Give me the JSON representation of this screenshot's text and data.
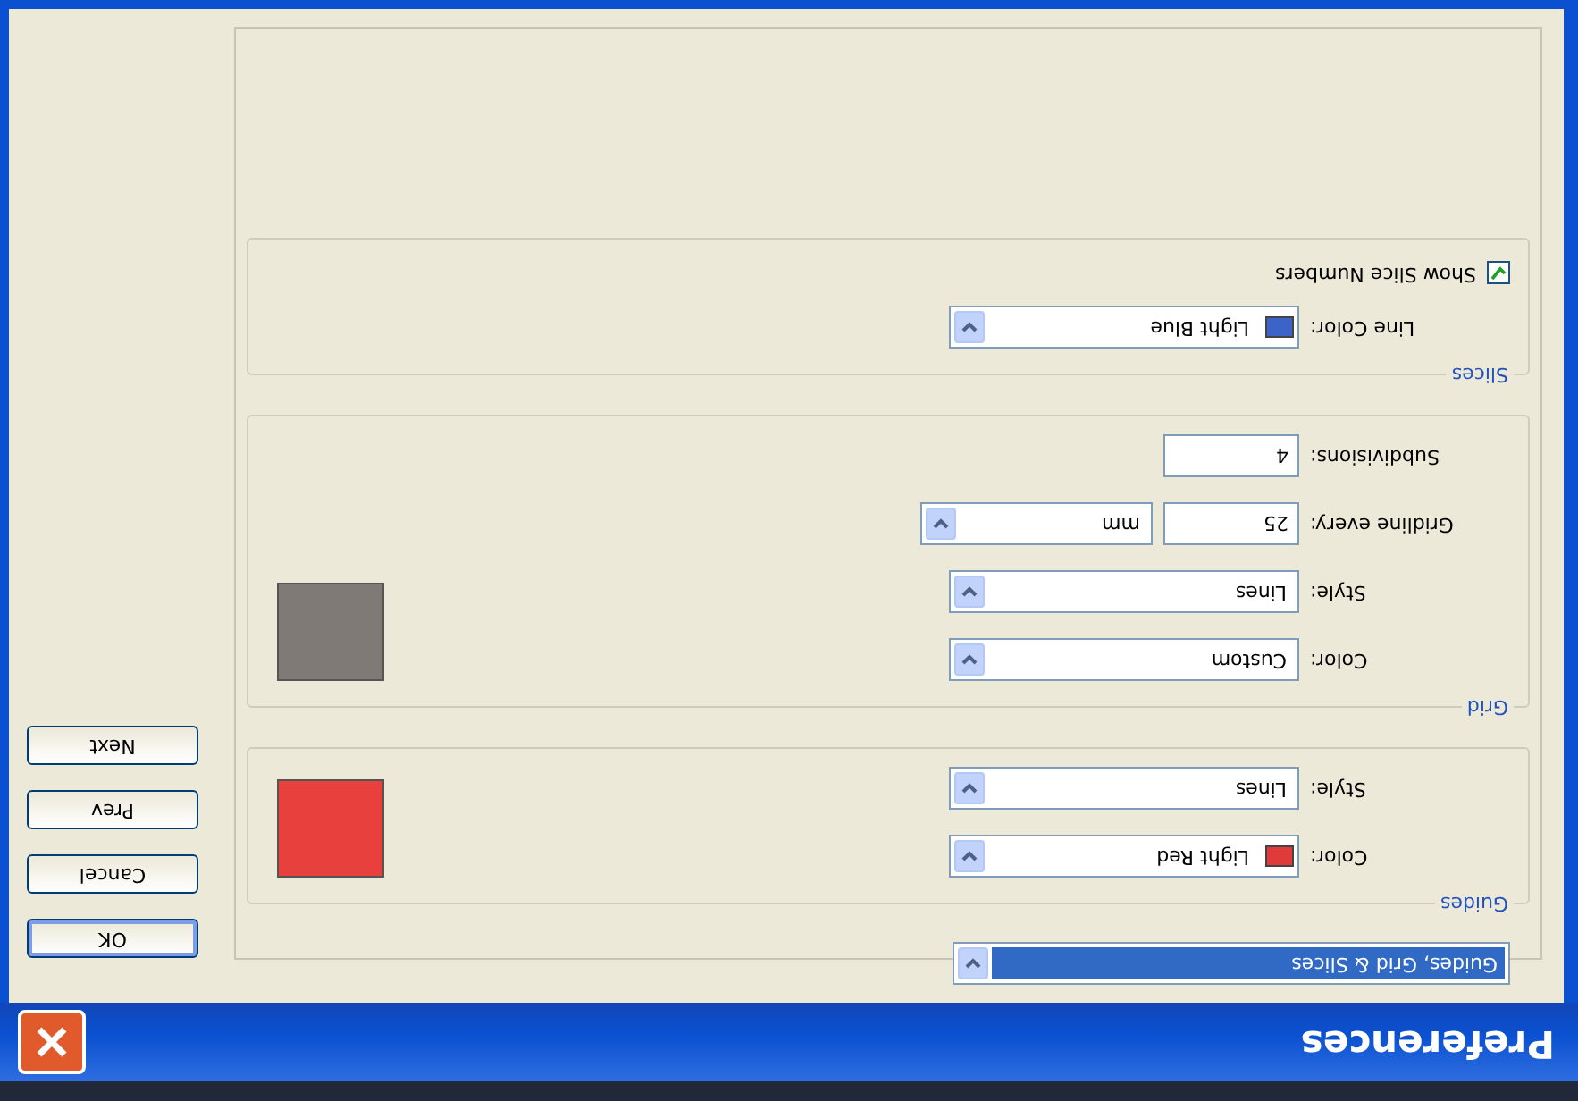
{
  "window": {
    "title": "Preferences"
  },
  "section_menu": {
    "value": "Guides, Grid & Slices"
  },
  "sections": [
    {
      "legend": "Guides",
      "color": "#e8403c",
      "fields": [
        {
          "kind": "color_select",
          "label": "Color:",
          "value": "Light Red",
          "color": "#e03a3a"
        },
        {
          "kind": "select",
          "label": "Style:",
          "value": "Lines"
        }
      ]
    },
    {
      "legend": "Grid",
      "color": "#7f7a76",
      "fields": [
        {
          "kind": "select",
          "label": "Color:",
          "value": "Custom"
        },
        {
          "kind": "select",
          "label": "Style:",
          "value": "Lines"
        },
        {
          "kind": "input_select",
          "label": "Gridline every:",
          "value": "25",
          "unit": "mm"
        },
        {
          "kind": "input",
          "label": "Subdivisions:",
          "value": "4"
        }
      ]
    },
    {
      "legend": "Slices",
      "fields": [
        {
          "kind": "color_select",
          "label": "Line Color:",
          "value": "Light Blue",
          "color": "#3c64c8"
        },
        {
          "kind": "checkbox",
          "label": "Show Slice Numbers",
          "checked": true
        }
      ]
    }
  ],
  "buttons": [
    {
      "label": "OK",
      "default": true
    },
    {
      "label": "Cancel",
      "default": false
    },
    {
      "label": "Prev",
      "default": false
    },
    {
      "label": "Next",
      "default": false
    }
  ]
}
